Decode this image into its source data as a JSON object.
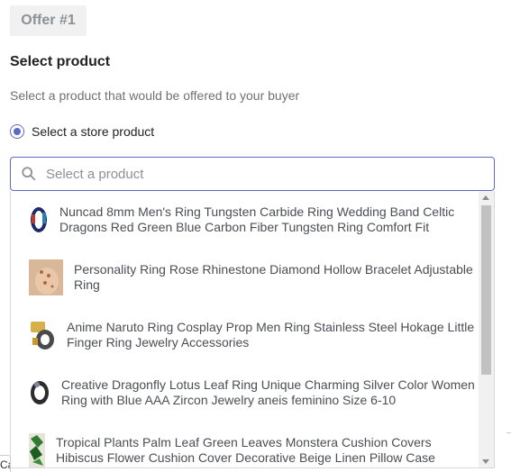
{
  "offer": {
    "tab_label": "Offer #1"
  },
  "section": {
    "title": "Select product",
    "helper": "Select a product that would be offered to your buyer"
  },
  "radio": {
    "label": "Select a store product",
    "checked": true
  },
  "search": {
    "placeholder": "Select a product",
    "value": ""
  },
  "products": [
    {
      "title": "Nuncad 8mm Men's Ring Tungsten Carbide Ring Wedding Band Celtic Dragons Red Green Blue Carbon Fiber Tungsten Ring Comfort Fit",
      "icon": "ring-product-thumbnail"
    },
    {
      "title": "Personality Ring Rose Rhinestone Diamond Hollow Bracelet Adjustable Ring",
      "icon": "bracelet-product-thumbnail"
    },
    {
      "title": "Anime Naruto Ring Cosplay Prop Men Ring Stainless Steel Hokage Little Finger Ring Jewelry Accessories",
      "icon": "ring-product-thumbnail"
    },
    {
      "title": "Creative Dragonfly Lotus Leaf Ring Unique Charming Silver Color Women Ring with Blue AAA Zircon Jewelry aneis feminino Size 6-10",
      "icon": "ring-product-thumbnail"
    },
    {
      "title": "Tropical Plants Palm Leaf Green Leaves Monstera Cushion Covers Hibiscus Flower Cushion Cover Decorative Beige Linen Pillow Case",
      "icon": "cushion-product-thumbnail"
    }
  ],
  "footer": {
    "cut_button_label": "Ca"
  },
  "colors": {
    "accent": "#5c6ac4",
    "tab_bg": "#f1f1f1",
    "muted_text": "#6d7175"
  }
}
